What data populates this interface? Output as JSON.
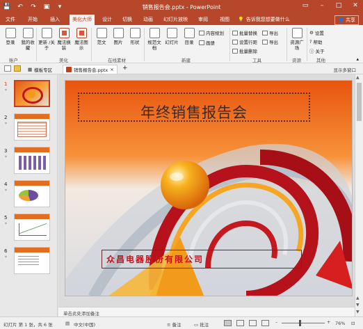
{
  "window": {
    "title": "销售报告会.pptx - PowerPoint",
    "user": "登录",
    "qat_icons": [
      "save-icon",
      "undo-icon",
      "redo-icon",
      "present-icon",
      "customize-icon"
    ]
  },
  "tabs": [
    "文件",
    "开始",
    "插入",
    "美化大师",
    "设计",
    "切换",
    "动画",
    "幻灯片放映",
    "审阅",
    "视图"
  ],
  "active_tab": "美化大师",
  "tell_me": "告诉我您想要做什么",
  "share": "共享",
  "ribbon": {
    "buttons": [
      {
        "label": "登录"
      },
      {
        "label": "我的收藏"
      },
      {
        "label": "更新 /关于"
      },
      {
        "label": "魔法换装"
      },
      {
        "label": "魔法图示"
      },
      {
        "label": "范文"
      },
      {
        "label": "图片"
      },
      {
        "label": "形状"
      },
      {
        "label": "规范文档"
      },
      {
        "label": "幻灯片"
      },
      {
        "label": "目录"
      },
      {
        "label": "资源广场"
      }
    ],
    "small_items": {
      "new_label": "内容规划",
      "new_label2": "画册",
      "tools1": "批量替换",
      "tools2": "设置行距",
      "tools3": "批量删除",
      "tools4": "导出",
      "tools5": "导出",
      "tools6": "设置",
      "tools7": "帮助",
      "tools8": "关于"
    },
    "groups": [
      "账户",
      "美化",
      "在线素材",
      "新建",
      "工具",
      "资源",
      "其他"
    ]
  },
  "file_tabs": {
    "home": "模板专区",
    "active": "销售报告会.pptx",
    "add": "+",
    "show_more": "显示多窗口"
  },
  "slides": [
    {
      "num": "1",
      "star": "*"
    },
    {
      "num": "2",
      "star": "*"
    },
    {
      "num": "3",
      "star": "*"
    },
    {
      "num": "4",
      "star": "*"
    },
    {
      "num": "5",
      "star": "*"
    },
    {
      "num": "6",
      "star": "*"
    }
  ],
  "current_slide": {
    "title": "年终销售报告会",
    "company": "众昌电器股份有限公司"
  },
  "notes_placeholder": "单击此处添加备注",
  "status": {
    "slide_info": "幻灯片 第 1 张，共 6 张",
    "language": "中文(中国)",
    "notes_btn": "备注",
    "comments_btn": "批注",
    "zoom": "76%"
  },
  "colors": {
    "accent": "#b7472a",
    "slide_orange": "#f07a1e",
    "company_red": "#c8101a"
  }
}
